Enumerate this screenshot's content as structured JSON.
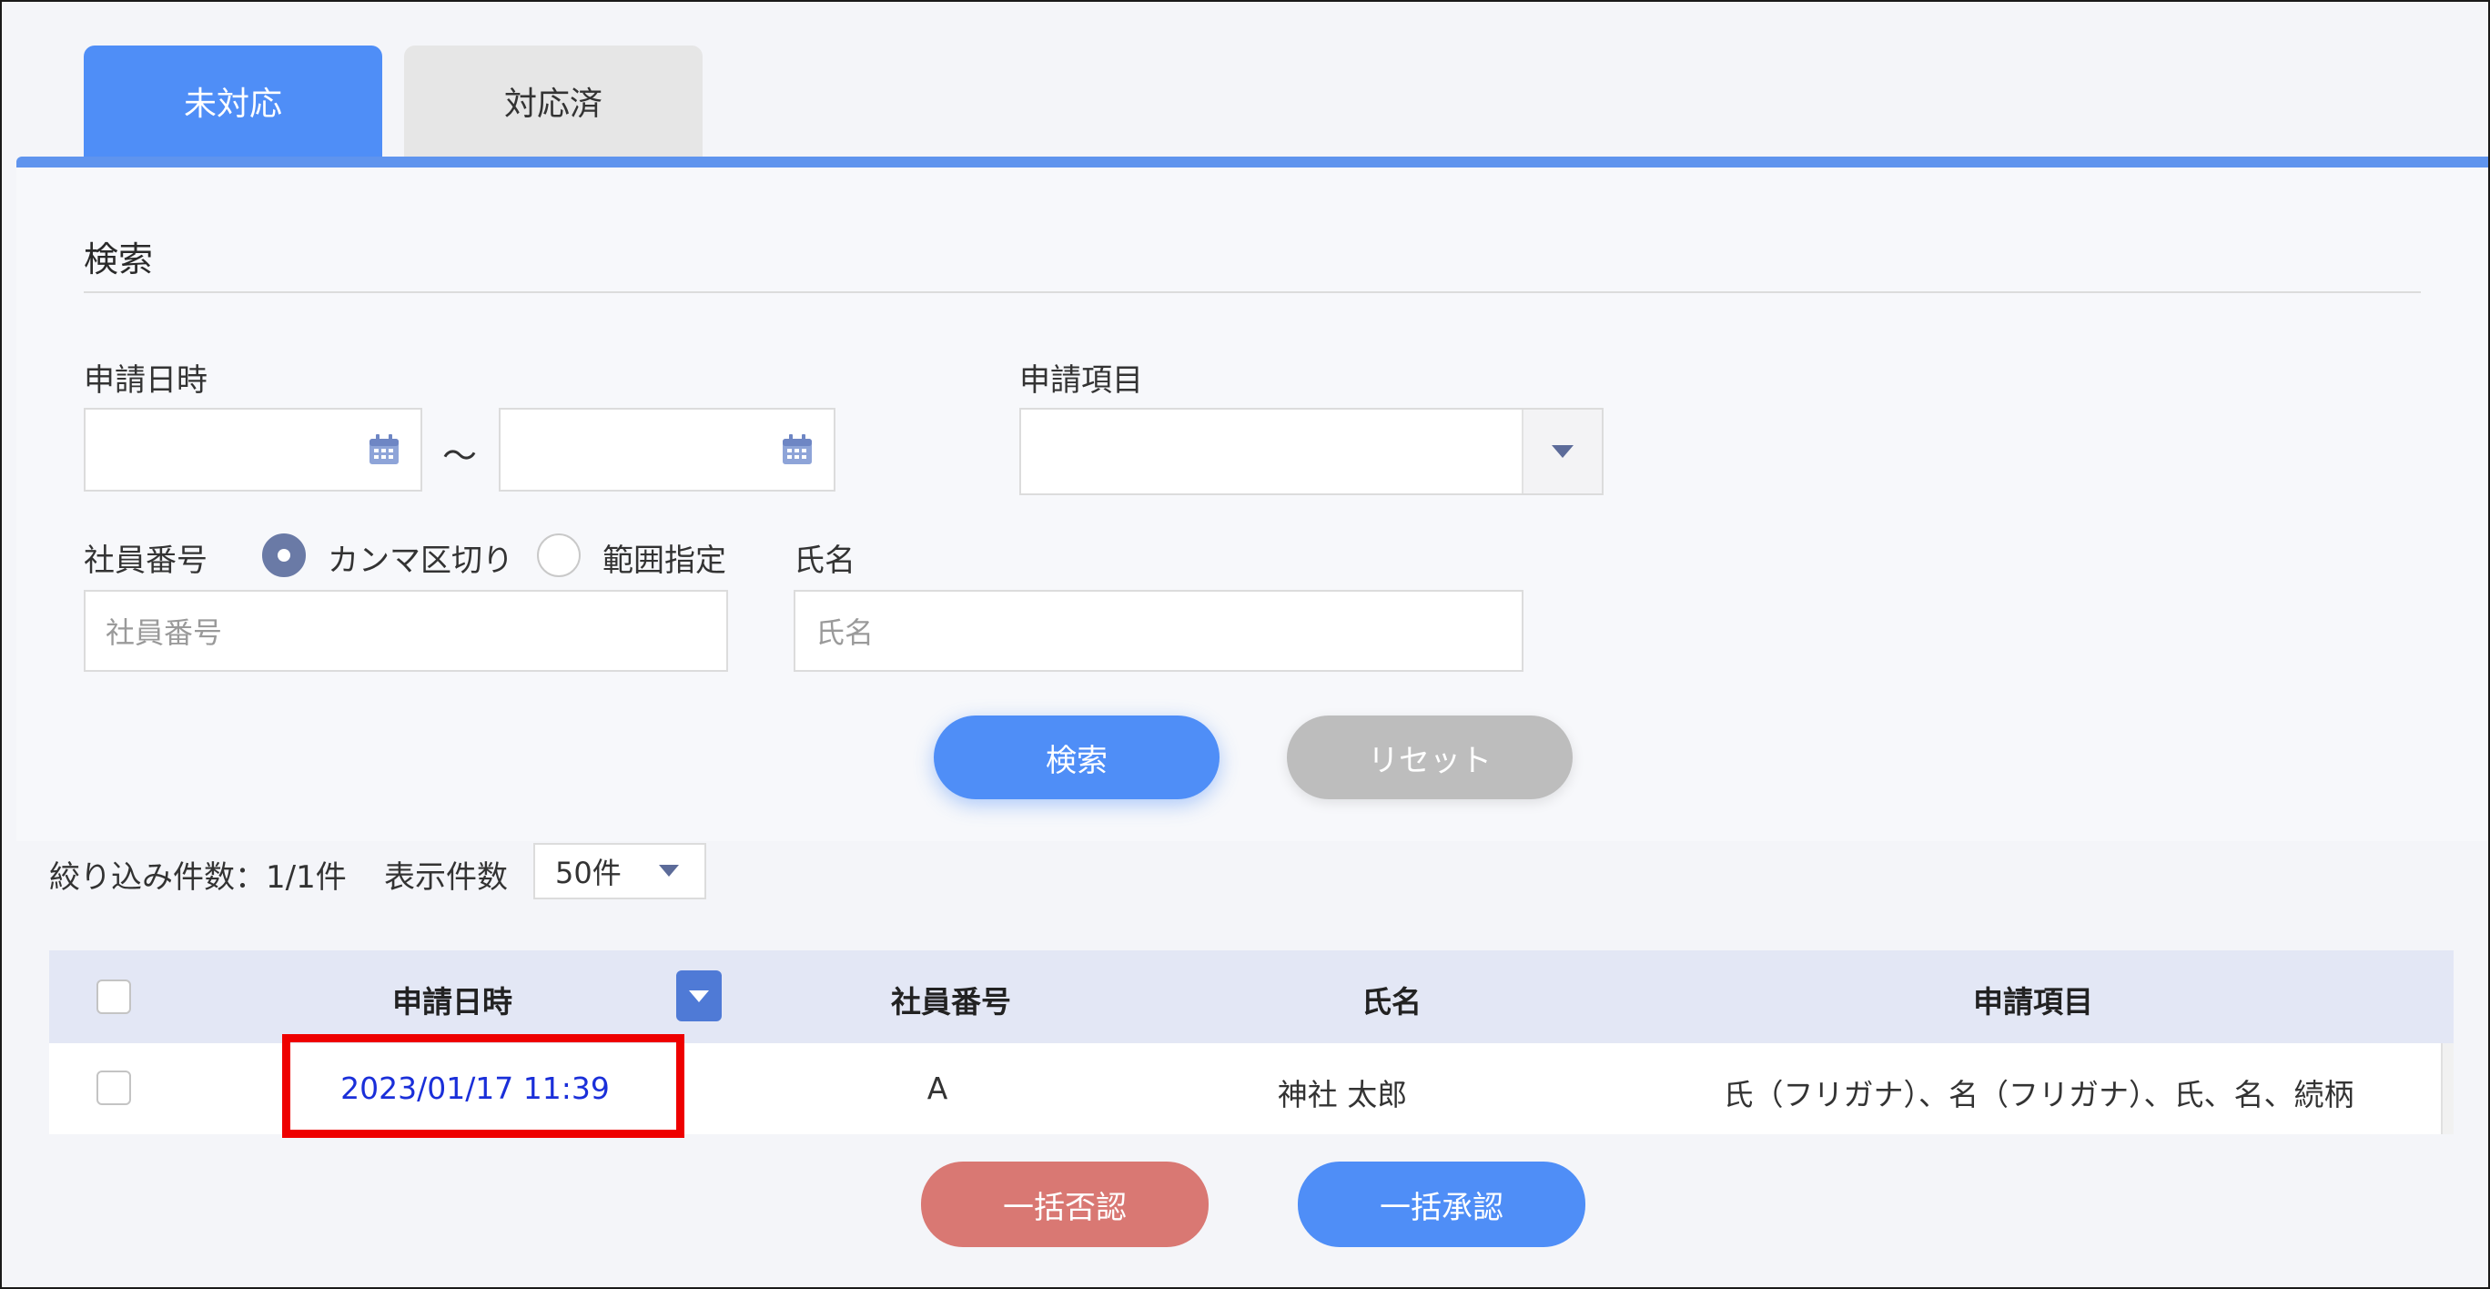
{
  "tabs": [
    {
      "label": "未対応",
      "active": true
    },
    {
      "label": "対応済",
      "active": false
    }
  ],
  "search": {
    "title": "検索",
    "date_label": "申請日時",
    "date_from_value": "",
    "date_to_value": "",
    "range_separator": "～",
    "item_label": "申請項目",
    "item_value": "",
    "employee_label": "社員番号",
    "radio_comma_label": "カンマ区切り",
    "radio_range_label": "範囲指定",
    "radio_selected": "カンマ区切り",
    "employee_placeholder": "社員番号",
    "name_label": "氏名",
    "name_placeholder": "氏名",
    "search_button": "検索",
    "reset_button": "リセット"
  },
  "results": {
    "filter_count": "絞り込み件数：1/1件",
    "display_count_label": "表示件数",
    "display_count_value": "50件"
  },
  "table": {
    "columns": [
      "申請日時",
      "社員番号",
      "氏名",
      "申請項目"
    ],
    "rows": [
      {
        "date": "2023/01/17 11:39",
        "employee_no": "A",
        "name": "神社 太郎",
        "items": "氏（フリガナ）、名（フリガナ）、氏、名、続柄"
      }
    ]
  },
  "actions": {
    "reject_all": "一括否認",
    "approve_all": "一括承認"
  },
  "colors": {
    "accent": "#4f8ef7",
    "danger": "#d97873",
    "highlight": "#ee0000",
    "link": "#1a2fd9"
  },
  "icons": [
    "calendar-icon",
    "chevron-down-icon",
    "sort-desc-icon"
  ]
}
